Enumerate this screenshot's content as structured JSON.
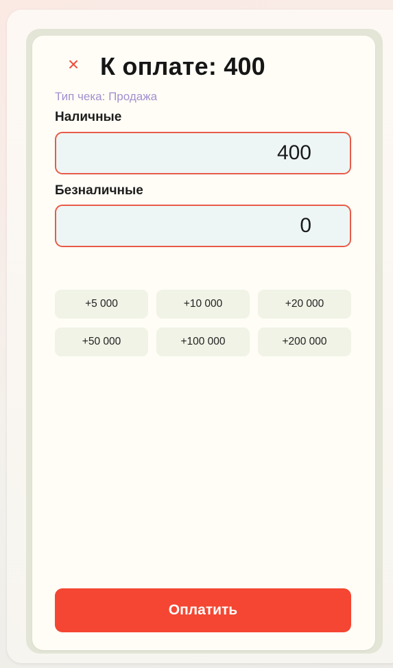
{
  "header": {
    "title": "К оплате: 400",
    "subtitle": "Тип чека: Продажа",
    "close_icon": "close-icon"
  },
  "fields": {
    "cash": {
      "label": "Наличные",
      "value": "400"
    },
    "card": {
      "label": "Безналичные",
      "value": "0"
    }
  },
  "quick_amounts": [
    "+5 000",
    "+10 000",
    "+20 000",
    "+50 000",
    "+100 000",
    "+200 000"
  ],
  "pay_button": {
    "label": "Оплатить"
  },
  "colors": {
    "accent": "#f44632",
    "input_border": "#e85a48",
    "subtitle": "#a18fd0",
    "quick_button_bg": "#f0f3e6"
  }
}
